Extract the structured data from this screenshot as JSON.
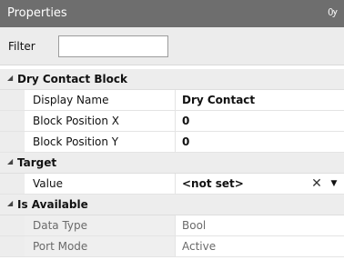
{
  "panel": {
    "title": "Properties",
    "pin_icon": "pin-icon",
    "pin_glyph": "Ѹ"
  },
  "filter": {
    "label": "Filter",
    "value": ""
  },
  "expander_glyph": "◢",
  "categories": [
    {
      "name": "Dry Contact Block",
      "properties": [
        {
          "name": "Display Name",
          "value": "Dry Contact"
        },
        {
          "name": "Block Position X",
          "value": "0"
        },
        {
          "name": "Block Position Y",
          "value": "0"
        }
      ]
    },
    {
      "name": "Target",
      "properties": [
        {
          "name": "Value",
          "value": "<not set>",
          "clear_glyph": "✕",
          "dropdown_glyph": "▼"
        }
      ]
    },
    {
      "name": "Is Available",
      "properties": [
        {
          "name": "Data Type",
          "value": "Bool"
        },
        {
          "name": "Port Mode",
          "value": "Active"
        }
      ]
    }
  ],
  "colors": {
    "titlebar": "#6e6e6e",
    "category_bg": "#ededed",
    "disabled_text": "#6a6a6a"
  }
}
